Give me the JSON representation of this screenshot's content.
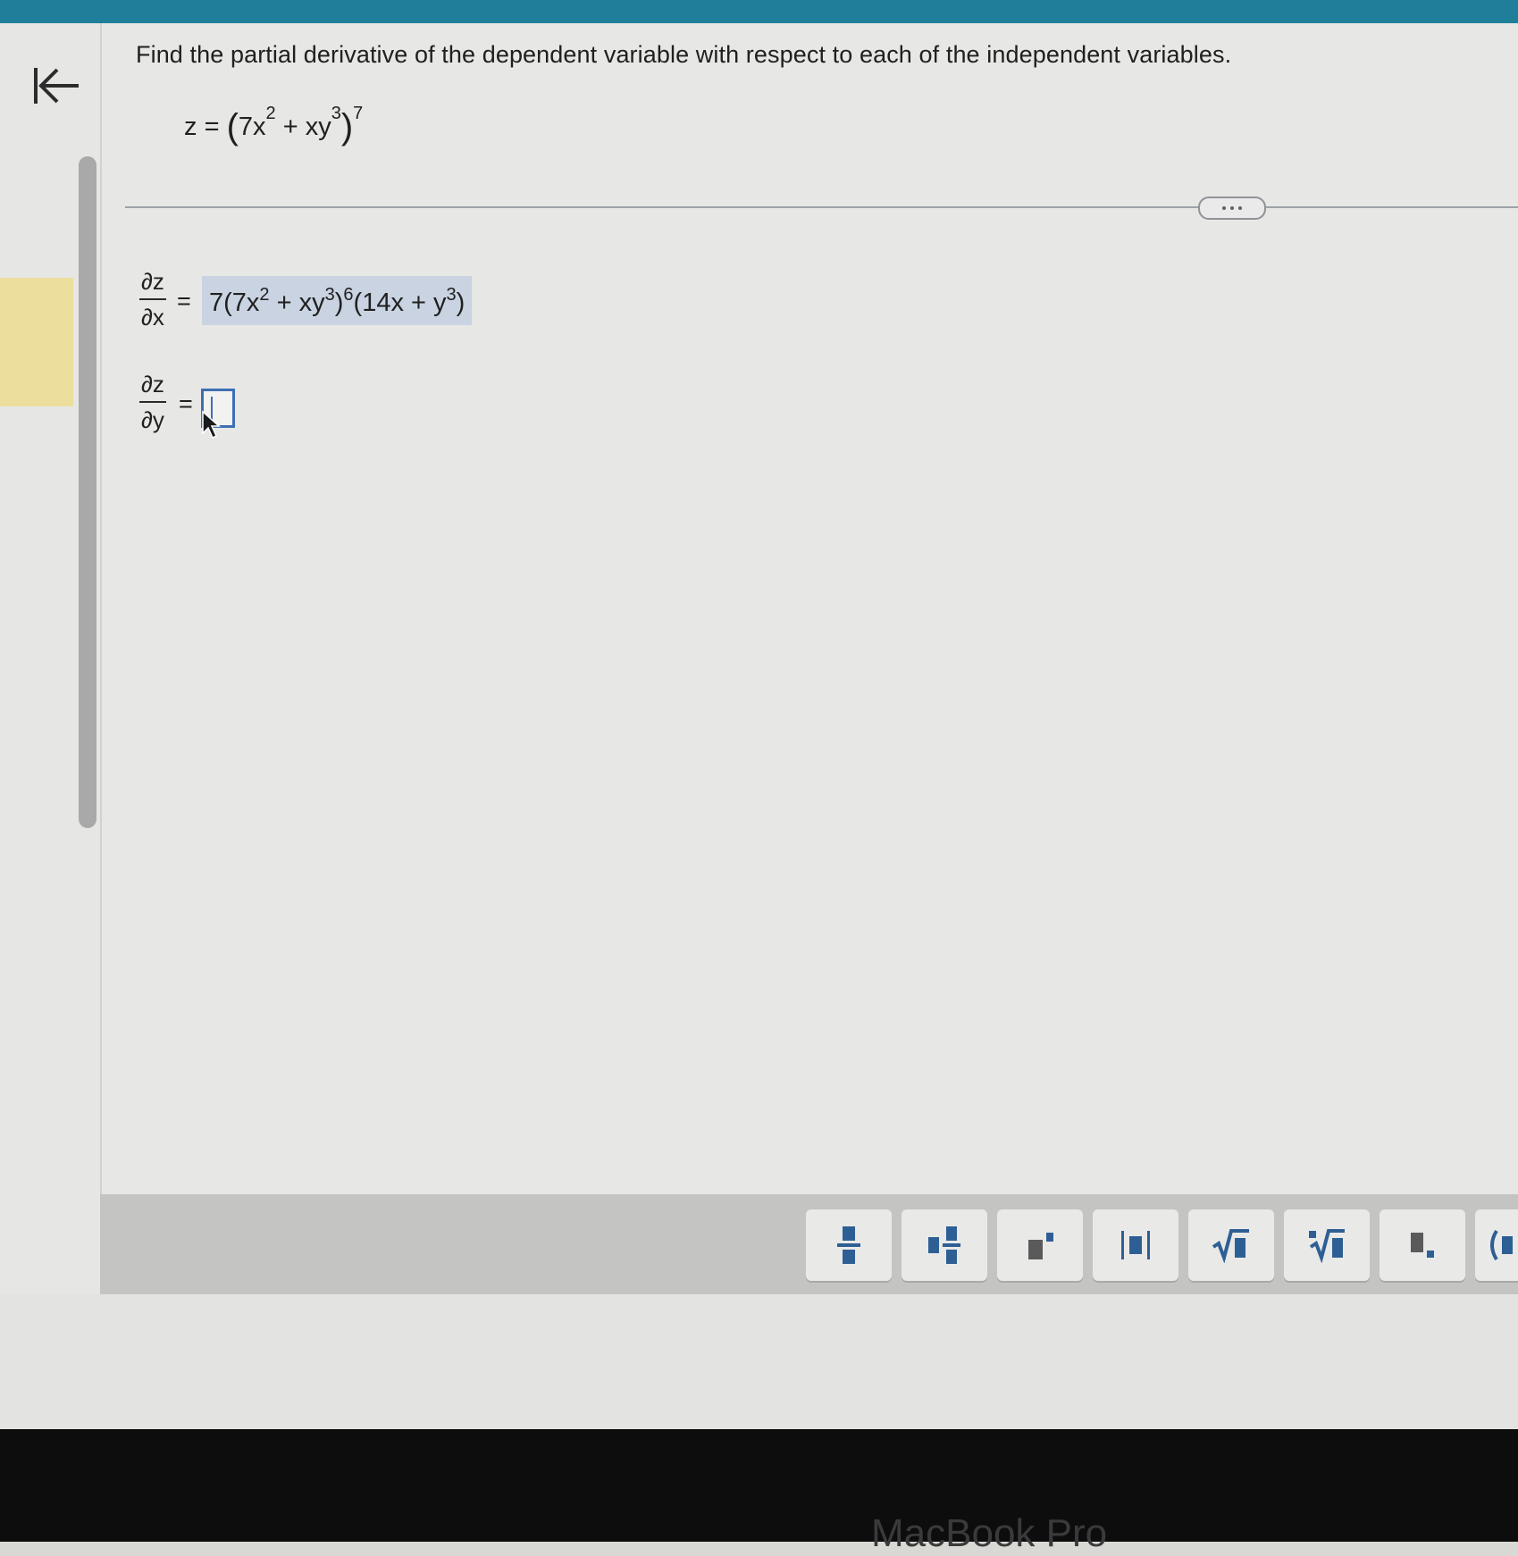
{
  "question": {
    "prompt": "Find the partial derivative of the dependent variable with respect to each of the independent variables.",
    "function_lhs": "z",
    "function_eq": "=",
    "function_open": "(",
    "function_base": "7x",
    "function_pow1": "2",
    "function_mid": " + xy",
    "function_pow2": "3",
    "function_close": ")",
    "function_exponent": "7"
  },
  "answers": {
    "dzdx_num": "∂z",
    "dzdx_den": "∂x",
    "dzdx_eq": "=",
    "dzdx_part1": "7(7x",
    "dzdx_pow1": "2",
    "dzdx_part2": " + xy",
    "dzdx_pow2": "3",
    "dzdx_part3": ")",
    "dzdx_pow3": "6",
    "dzdx_part4": "(14x + y",
    "dzdx_pow4": "3",
    "dzdx_part5": ")",
    "dzdy_num": "∂z",
    "dzdy_den": "∂y",
    "dzdy_eq": "=",
    "dzdy_value": ""
  },
  "toolbar": {
    "fraction_icon": "fraction-icon",
    "mixed_number_icon": "mixed-number-icon",
    "superscript_icon": "superscript-icon",
    "absolute_value_icon": "absolute-value-icon",
    "sqrt_icon": "square-root-icon",
    "nth_root_icon": "nth-root-icon",
    "subscript_icon": "subscript-icon",
    "parenthesis_icon": "parenthesis-icon"
  },
  "device": {
    "label": "MacBook Pro"
  },
  "colors": {
    "top_bar": "#1f7f9b",
    "answer_highlight": "#c9d3e2",
    "input_border": "#3f6fb3",
    "side_highlight": "#ecdf9e"
  }
}
